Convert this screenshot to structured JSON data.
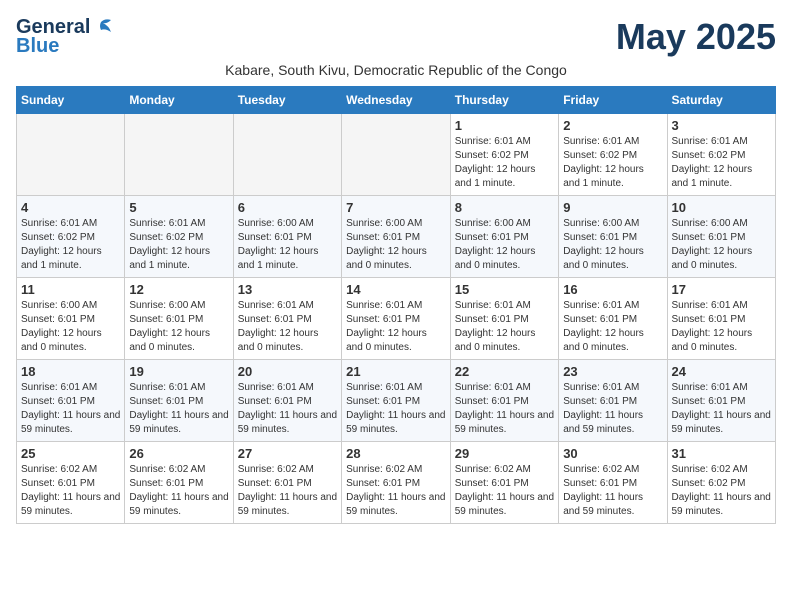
{
  "header": {
    "logo_general": "General",
    "logo_blue": "Blue",
    "month_title": "May 2025",
    "location": "Kabare, South Kivu, Democratic Republic of the Congo"
  },
  "days_of_week": [
    "Sunday",
    "Monday",
    "Tuesday",
    "Wednesday",
    "Thursday",
    "Friday",
    "Saturday"
  ],
  "weeks": [
    [
      {
        "day": "",
        "info": ""
      },
      {
        "day": "",
        "info": ""
      },
      {
        "day": "",
        "info": ""
      },
      {
        "day": "",
        "info": ""
      },
      {
        "day": "1",
        "info": "Sunrise: 6:01 AM\nSunset: 6:02 PM\nDaylight: 12 hours and 1 minute."
      },
      {
        "day": "2",
        "info": "Sunrise: 6:01 AM\nSunset: 6:02 PM\nDaylight: 12 hours and 1 minute."
      },
      {
        "day": "3",
        "info": "Sunrise: 6:01 AM\nSunset: 6:02 PM\nDaylight: 12 hours and 1 minute."
      }
    ],
    [
      {
        "day": "4",
        "info": "Sunrise: 6:01 AM\nSunset: 6:02 PM\nDaylight: 12 hours and 1 minute."
      },
      {
        "day": "5",
        "info": "Sunrise: 6:01 AM\nSunset: 6:02 PM\nDaylight: 12 hours and 1 minute."
      },
      {
        "day": "6",
        "info": "Sunrise: 6:00 AM\nSunset: 6:01 PM\nDaylight: 12 hours and 1 minute."
      },
      {
        "day": "7",
        "info": "Sunrise: 6:00 AM\nSunset: 6:01 PM\nDaylight: 12 hours and 0 minutes."
      },
      {
        "day": "8",
        "info": "Sunrise: 6:00 AM\nSunset: 6:01 PM\nDaylight: 12 hours and 0 minutes."
      },
      {
        "day": "9",
        "info": "Sunrise: 6:00 AM\nSunset: 6:01 PM\nDaylight: 12 hours and 0 minutes."
      },
      {
        "day": "10",
        "info": "Sunrise: 6:00 AM\nSunset: 6:01 PM\nDaylight: 12 hours and 0 minutes."
      }
    ],
    [
      {
        "day": "11",
        "info": "Sunrise: 6:00 AM\nSunset: 6:01 PM\nDaylight: 12 hours and 0 minutes."
      },
      {
        "day": "12",
        "info": "Sunrise: 6:00 AM\nSunset: 6:01 PM\nDaylight: 12 hours and 0 minutes."
      },
      {
        "day": "13",
        "info": "Sunrise: 6:01 AM\nSunset: 6:01 PM\nDaylight: 12 hours and 0 minutes."
      },
      {
        "day": "14",
        "info": "Sunrise: 6:01 AM\nSunset: 6:01 PM\nDaylight: 12 hours and 0 minutes."
      },
      {
        "day": "15",
        "info": "Sunrise: 6:01 AM\nSunset: 6:01 PM\nDaylight: 12 hours and 0 minutes."
      },
      {
        "day": "16",
        "info": "Sunrise: 6:01 AM\nSunset: 6:01 PM\nDaylight: 12 hours and 0 minutes."
      },
      {
        "day": "17",
        "info": "Sunrise: 6:01 AM\nSunset: 6:01 PM\nDaylight: 12 hours and 0 minutes."
      }
    ],
    [
      {
        "day": "18",
        "info": "Sunrise: 6:01 AM\nSunset: 6:01 PM\nDaylight: 11 hours and 59 minutes."
      },
      {
        "day": "19",
        "info": "Sunrise: 6:01 AM\nSunset: 6:01 PM\nDaylight: 11 hours and 59 minutes."
      },
      {
        "day": "20",
        "info": "Sunrise: 6:01 AM\nSunset: 6:01 PM\nDaylight: 11 hours and 59 minutes."
      },
      {
        "day": "21",
        "info": "Sunrise: 6:01 AM\nSunset: 6:01 PM\nDaylight: 11 hours and 59 minutes."
      },
      {
        "day": "22",
        "info": "Sunrise: 6:01 AM\nSunset: 6:01 PM\nDaylight: 11 hours and 59 minutes."
      },
      {
        "day": "23",
        "info": "Sunrise: 6:01 AM\nSunset: 6:01 PM\nDaylight: 11 hours and 59 minutes."
      },
      {
        "day": "24",
        "info": "Sunrise: 6:01 AM\nSunset: 6:01 PM\nDaylight: 11 hours and 59 minutes."
      }
    ],
    [
      {
        "day": "25",
        "info": "Sunrise: 6:02 AM\nSunset: 6:01 PM\nDaylight: 11 hours and 59 minutes."
      },
      {
        "day": "26",
        "info": "Sunrise: 6:02 AM\nSunset: 6:01 PM\nDaylight: 11 hours and 59 minutes."
      },
      {
        "day": "27",
        "info": "Sunrise: 6:02 AM\nSunset: 6:01 PM\nDaylight: 11 hours and 59 minutes."
      },
      {
        "day": "28",
        "info": "Sunrise: 6:02 AM\nSunset: 6:01 PM\nDaylight: 11 hours and 59 minutes."
      },
      {
        "day": "29",
        "info": "Sunrise: 6:02 AM\nSunset: 6:01 PM\nDaylight: 11 hours and 59 minutes."
      },
      {
        "day": "30",
        "info": "Sunrise: 6:02 AM\nSunset: 6:01 PM\nDaylight: 11 hours and 59 minutes."
      },
      {
        "day": "31",
        "info": "Sunrise: 6:02 AM\nSunset: 6:02 PM\nDaylight: 11 hours and 59 minutes."
      }
    ]
  ]
}
